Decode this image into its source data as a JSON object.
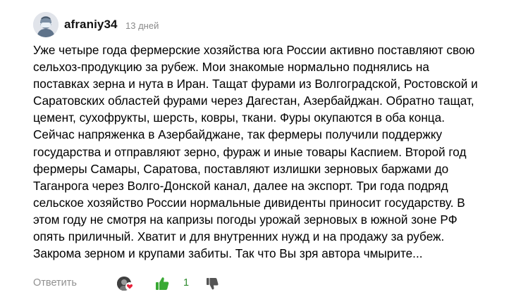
{
  "comment": {
    "username": "afraniy34",
    "timestamp": "13 дней",
    "text": "Уже четыре года фермерские хозяйства юга России активно поставляют свою\nсельхоз-продукцию за рубеж. Мои знакомые нормально поднялись на\nпоставках зерна и нута в Иран. Тащат фурами из Волгоградской, Ростовской и\nСаратовских областей фурами через Дагестан, Азербайджан. Обратно тащат,\nцемент, сухофрукты, шерсть, ковры, ткани. Фуры окупаются в оба конца.\nСейчас напряженка в Азербайджане, так фермеры получили поддержку\nгосударства и отправляют зерно, фураж и иные товары Каспием. Второй год\nфермеры Самары, Саратова, поставляют излишки зерновых баржами до\nТаганрога через Волго-Донской канал, далее на экспорт. Три года подряд\nсельское хозяйство России нормальные дивиденты приносит государству. В\nэтом году не смотря на капризы погоды урожай зерновых в южной зоне РФ\nопять приличный. Хватит и для внутренних нужд и на продажу за рубеж.\nЗакрома зерном и крупами забиты. Так что Вы зря автора чмырите..."
  },
  "actions": {
    "reply_label": "Ответить",
    "like_count": "1",
    "like_icon": "thumbs-up-icon",
    "dislike_icon": "thumbs-down-icon",
    "reaction_icon": "heart-icon"
  },
  "colors": {
    "like_green": "#3aa935",
    "dislike_gray": "#555555",
    "heart_red": "#e8233b",
    "muted_text": "#909090"
  }
}
